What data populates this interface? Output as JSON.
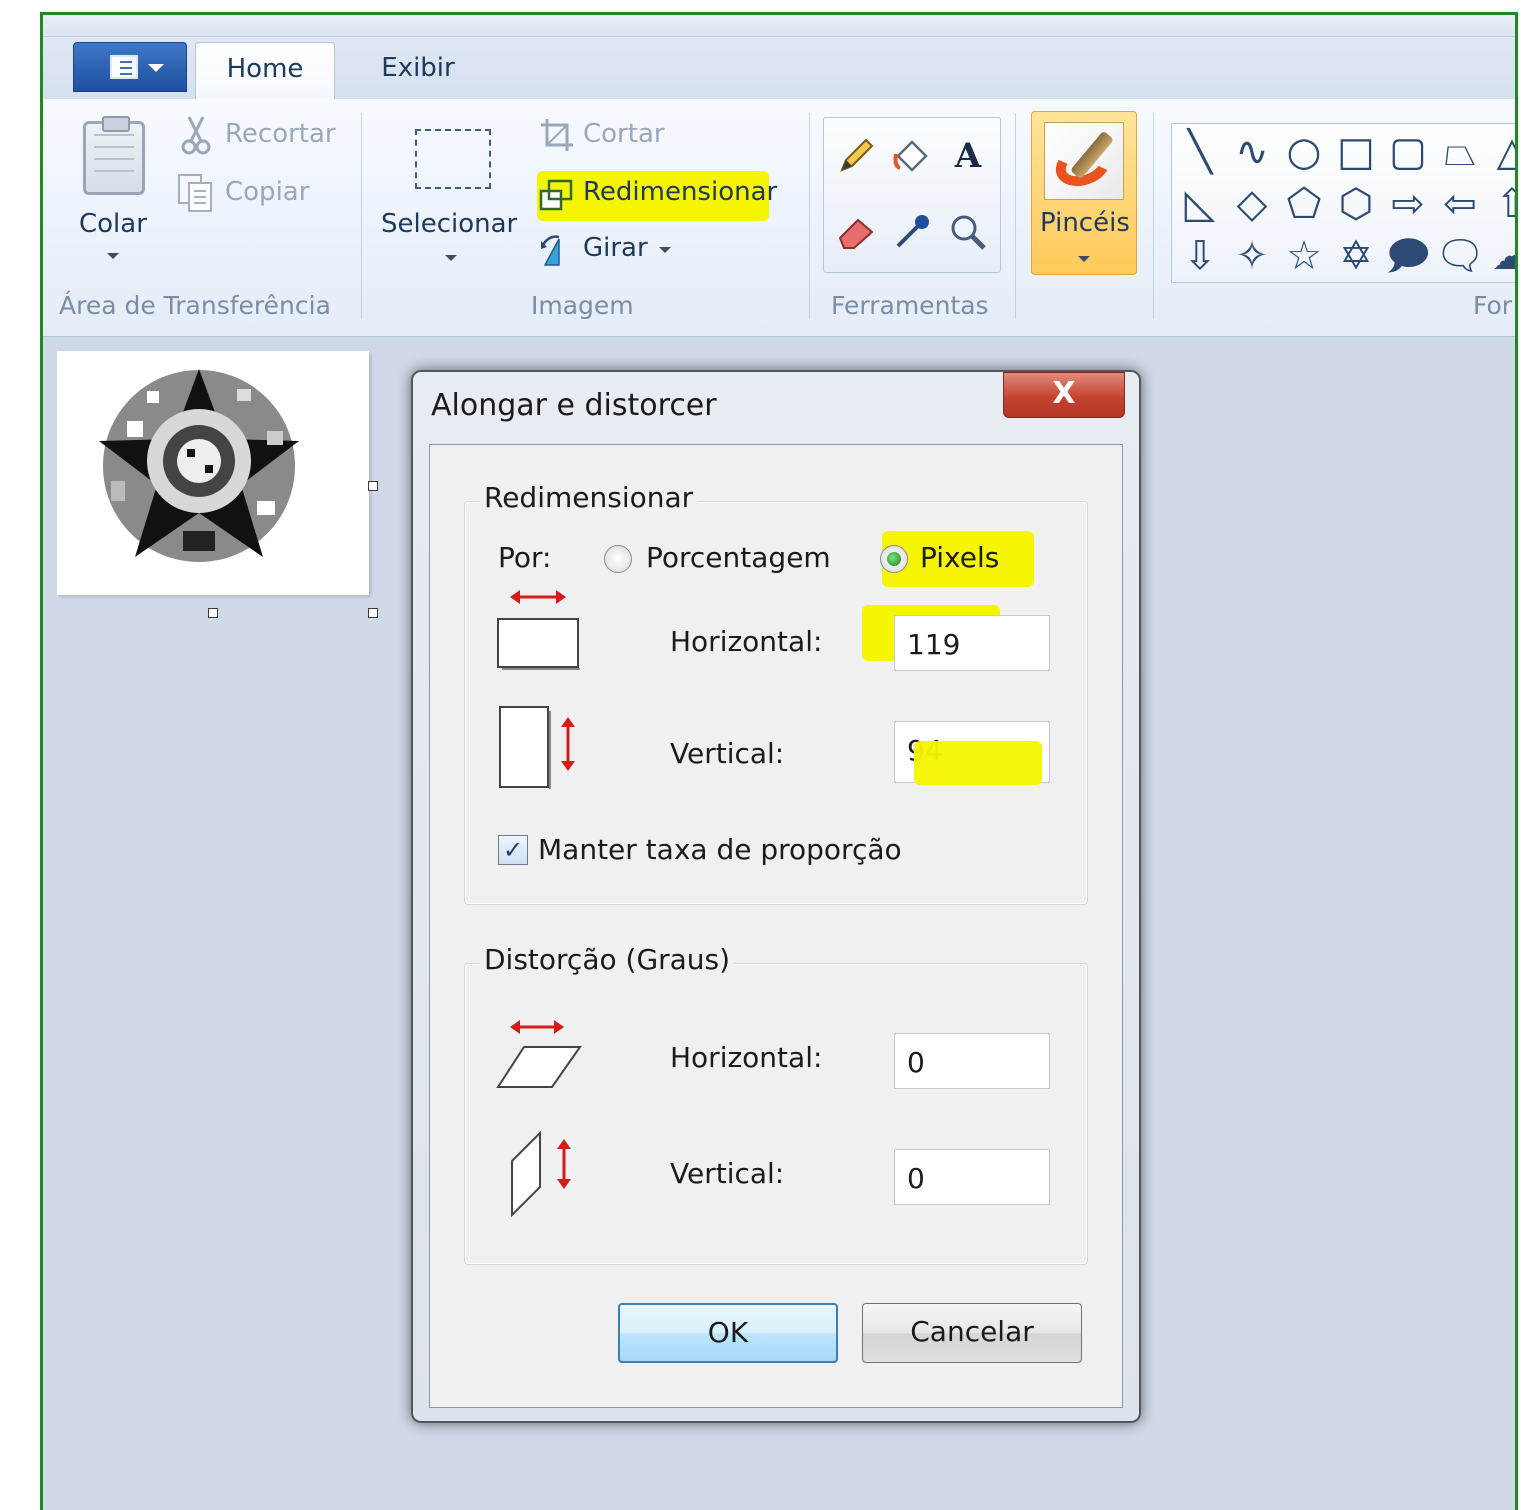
{
  "ribbon": {
    "tabs": [
      {
        "label": "Home",
        "active": true
      },
      {
        "label": "Exibir",
        "active": false
      }
    ],
    "clipboard": {
      "paste_label": "Colar",
      "cut_label": "Recortar",
      "copy_label": "Copiar",
      "group_label": "Área de Transferência"
    },
    "image": {
      "select_label": "Selecionar",
      "crop_label": "Cortar",
      "resize_label": "Redimensionar",
      "rotate_label": "Girar",
      "group_label": "Imagem"
    },
    "tools": {
      "group_label": "Ferramentas",
      "icons": [
        "pencil-icon",
        "fill-icon",
        "text-icon",
        "eraser-icon",
        "color-picker-icon",
        "magnifier-icon"
      ],
      "text_tool_glyph": "A"
    },
    "brushes": {
      "label": "Pincéis"
    },
    "shapes": {
      "group_label_partial": "For"
    }
  },
  "dialog": {
    "title": "Alongar e distorcer",
    "close_glyph": "X",
    "resize": {
      "legend": "Redimensionar",
      "by_label": "Por:",
      "option_percent": "Porcentagem",
      "option_pixels": "Pixels",
      "selected": "Pixels",
      "horizontal_label": "Horizontal:",
      "horizontal_value": "119",
      "vertical_label": "Vertical:",
      "vertical_value": "94",
      "keep_ratio_label": "Manter taxa de proporção",
      "keep_ratio_checked": true,
      "check_glyph": "✓"
    },
    "skew": {
      "legend": "Distorção (Graus)",
      "horizontal_label": "Horizontal:",
      "horizontal_value": "0",
      "vertical_label": "Vertical:",
      "vertical_value": "0"
    },
    "ok_label": "OK",
    "cancel_label": "Cancelar"
  },
  "colors": {
    "highlight": "#f5f500",
    "window_border": "#1f8a1f",
    "arrow_red": "#d41a1a",
    "close_red": "#c4432f"
  }
}
